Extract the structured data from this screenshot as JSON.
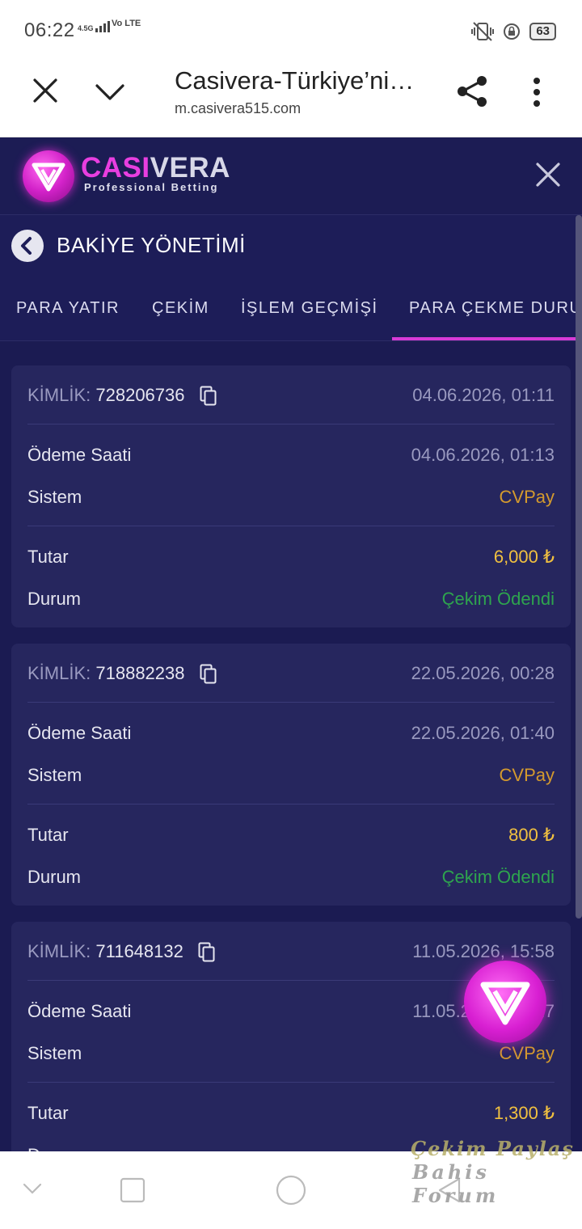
{
  "status_bar": {
    "time": "06:22",
    "network": "4.5G",
    "volte": "Vo LTE",
    "battery": "63"
  },
  "browser": {
    "title": "Casivera-Türkiye’nin...",
    "url": "m.casivera515.com"
  },
  "site": {
    "brand_part1": "CASI",
    "brand_part2": "VERA",
    "tagline": "Professional Betting"
  },
  "panel": {
    "title": "BAKİYE YÖNETİMİ"
  },
  "tabs": [
    {
      "label": "PARA YATIR"
    },
    {
      "label": "ÇEKİM"
    },
    {
      "label": "İŞLEM GEÇMİŞİ"
    },
    {
      "label": "PARA ÇEKME DURUMU",
      "active": true
    }
  ],
  "labels": {
    "id": "KİMLİK:",
    "pay_time": "Ödeme Saati",
    "system": "Sistem",
    "amount": "Tutar",
    "status": "Durum"
  },
  "transactions": [
    {
      "id": "728206736",
      "created": "04.06.2026, 01:11",
      "pay_time": "04.06.2026, 01:13",
      "system": "CVPay",
      "amount": "6,000 ₺",
      "status": "Çekim Ödendi"
    },
    {
      "id": "718882238",
      "created": "22.05.2026, 00:28",
      "pay_time": "22.05.2026, 01:40",
      "system": "CVPay",
      "amount": "800 ₺",
      "status": "Çekim Ödendi"
    },
    {
      "id": "711648132",
      "created": "11.05.2026, 15:58",
      "pay_time": "11.05.2026, 16:17",
      "system": "CVPay",
      "amount": "1,300 ₺",
      "status": "Durum"
    }
  ],
  "watermark": {
    "line1": "Çekim Paylaş",
    "line2": "Bahis Forum"
  },
  "colors": {
    "accent": "#d63ad6",
    "system": "#d49a2e",
    "amount": "#f0c040",
    "success": "#2ea44e",
    "background": "#1b1b52"
  },
  "icons": [
    "close-icon",
    "chevron-down-icon",
    "share-icon",
    "more-vertical-icon",
    "back-chevron-icon",
    "copy-icon",
    "nav-back-icon",
    "nav-home-icon",
    "nav-recents-icon",
    "nav-collapse-icon"
  ]
}
